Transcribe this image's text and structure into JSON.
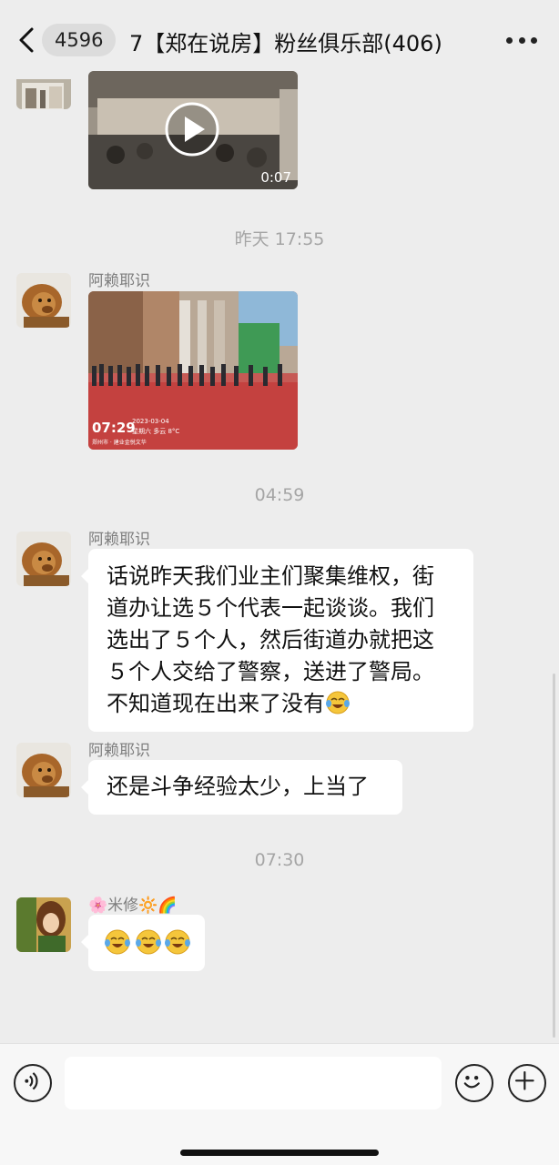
{
  "header": {
    "unread_count": "4596",
    "title": "7【郑在说房】粉丝俱乐部(406)"
  },
  "messages": [
    {
      "type": "video",
      "duration": "0:07"
    },
    {
      "type": "timestamp",
      "text": "昨天 17:55"
    },
    {
      "type": "image",
      "sender": "阿赖耶识",
      "overlay_time": "07:29",
      "overlay_date": "2023-03-04",
      "overlay_caption": "星期六 多云 8°C",
      "overlay_location": "郑州市 · 建业金悦文华"
    },
    {
      "type": "timestamp",
      "text": "04:59"
    },
    {
      "type": "text",
      "sender": "阿赖耶识",
      "lines": [
        "话说昨天我们业主们聚集维权，街",
        "道办让选５个代表一起谈谈。我们",
        "选出了５个人，然后街道办就把这",
        "５个人交给了警察，送进了警局。",
        "不知道现在出来了没有"
      ],
      "emoji": "face-with-tears-of-joy"
    },
    {
      "type": "text",
      "sender": "阿赖耶识",
      "lines": [
        "还是斗争经验太少，上当了"
      ]
    },
    {
      "type": "timestamp",
      "text": "07:30"
    },
    {
      "type": "emoji",
      "sender": "🌸米修🔆🌈",
      "emojis": [
        "face-with-tears-of-joy",
        "face-with-tears-of-joy",
        "face-with-tears-of-joy"
      ]
    }
  ],
  "input": {
    "placeholder": ""
  },
  "icons": {
    "back": "chevron-left-icon",
    "more": "more-dots-icon",
    "voice": "voice-icon",
    "emoji": "smiley-icon",
    "plus": "plus-icon"
  },
  "colors": {
    "background": "#ededed",
    "bubble": "#ffffff",
    "timestamp": "#a5a5a5",
    "sender": "#7e7e7e"
  }
}
